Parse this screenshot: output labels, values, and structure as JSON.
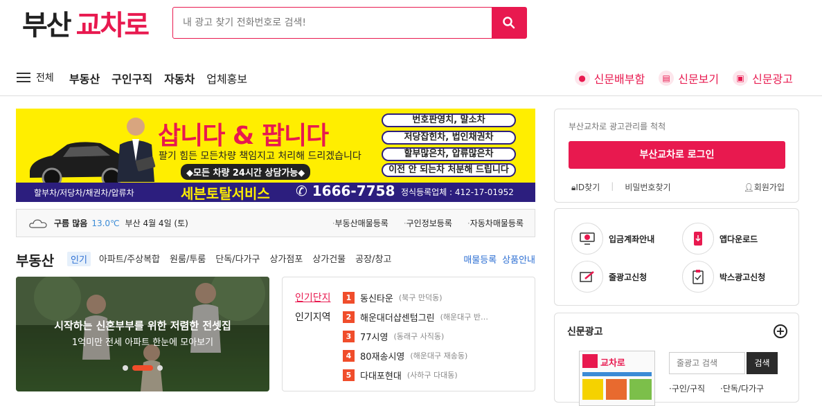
{
  "header": {
    "logo_part1": "부산",
    "logo_part2": "교차로",
    "search_placeholder": "내 광고 찾기 전화번호로 검색!"
  },
  "nav": {
    "menu_label": "전체",
    "links": [
      "부동산",
      "구인구직",
      "자동차",
      "업체홍보"
    ],
    "right_links": [
      "신문배부함",
      "신문보기",
      "신문광고"
    ]
  },
  "banner": {
    "title": "삽니다 & 팝니다",
    "subtitle": "팔기 힘든 모든차량 책임지고 처리해 드리겠습니다",
    "pill": "◆모든 차량 24시간 상담가능◆",
    "boxes": [
      "번호판영치, 말소차",
      "저당잡힌차, 법인채권차",
      "할부많은차, 압류많은차",
      "이전 안 되는차 처분해 드립니다"
    ],
    "bottom_left": "할부차/저당차/채권차/압류차",
    "company": "세븐토탈서비스",
    "phone": "1666-7758",
    "reg": "정식등록업체 : 412-17-01952"
  },
  "weather": {
    "condition": "구름 많음",
    "temp": "13.0℃",
    "location_date": "부산 4월 4일 (토)",
    "links": [
      "부동산매물등록",
      "구인정보등록",
      "자동차매물등록"
    ]
  },
  "realestate": {
    "title": "부동산",
    "tabs": [
      "인기",
      "아파트/주상복합",
      "원룸/투룸",
      "단독/다가구",
      "상가점포",
      "상가건물",
      "공장/창고"
    ],
    "right_links": [
      "매물등록",
      "상품안내"
    ],
    "slide_title": "시작하는 신혼부부를 위한 저렴한 전셋집",
    "slide_sub": "1억미만 전세 아파트 한눈에 모아보기",
    "pop_tabs": [
      "인기단지",
      "인기지역"
    ],
    "pop_list": [
      {
        "n": "1",
        "name": "동신타운",
        "area": "(북구 만덕동)"
      },
      {
        "n": "2",
        "name": "해운대더샵센텀그린",
        "area": "(해운대구 반…"
      },
      {
        "n": "3",
        "name": "77시영",
        "area": "(동래구 사직동)"
      },
      {
        "n": "4",
        "name": "80재송시영",
        "area": "(해운대구 재송동)"
      },
      {
        "n": "5",
        "name": "다대포현대",
        "area": "(사하구 다대동)"
      }
    ]
  },
  "login": {
    "caption": "부산교차로 광고관리를 척척",
    "button": "부산교차로 로그인",
    "find_id": "ID찾기",
    "find_pw": "비밀번호찾기",
    "join": "회원가입"
  },
  "quick": {
    "items": [
      "입금계좌안내",
      "앱다운로드",
      "줄광고신청",
      "박스광고신청"
    ]
  },
  "paper": {
    "title": "신문광고",
    "thumb_logo": "교차로",
    "search_placeholder": "줄광고 검색",
    "search_button": "검색",
    "cats": [
      "구인/구직",
      "단독/다가구"
    ]
  },
  "colors": {
    "brand": "#e8194f",
    "accent": "#f04d2b",
    "link": "#2d6fd3"
  }
}
